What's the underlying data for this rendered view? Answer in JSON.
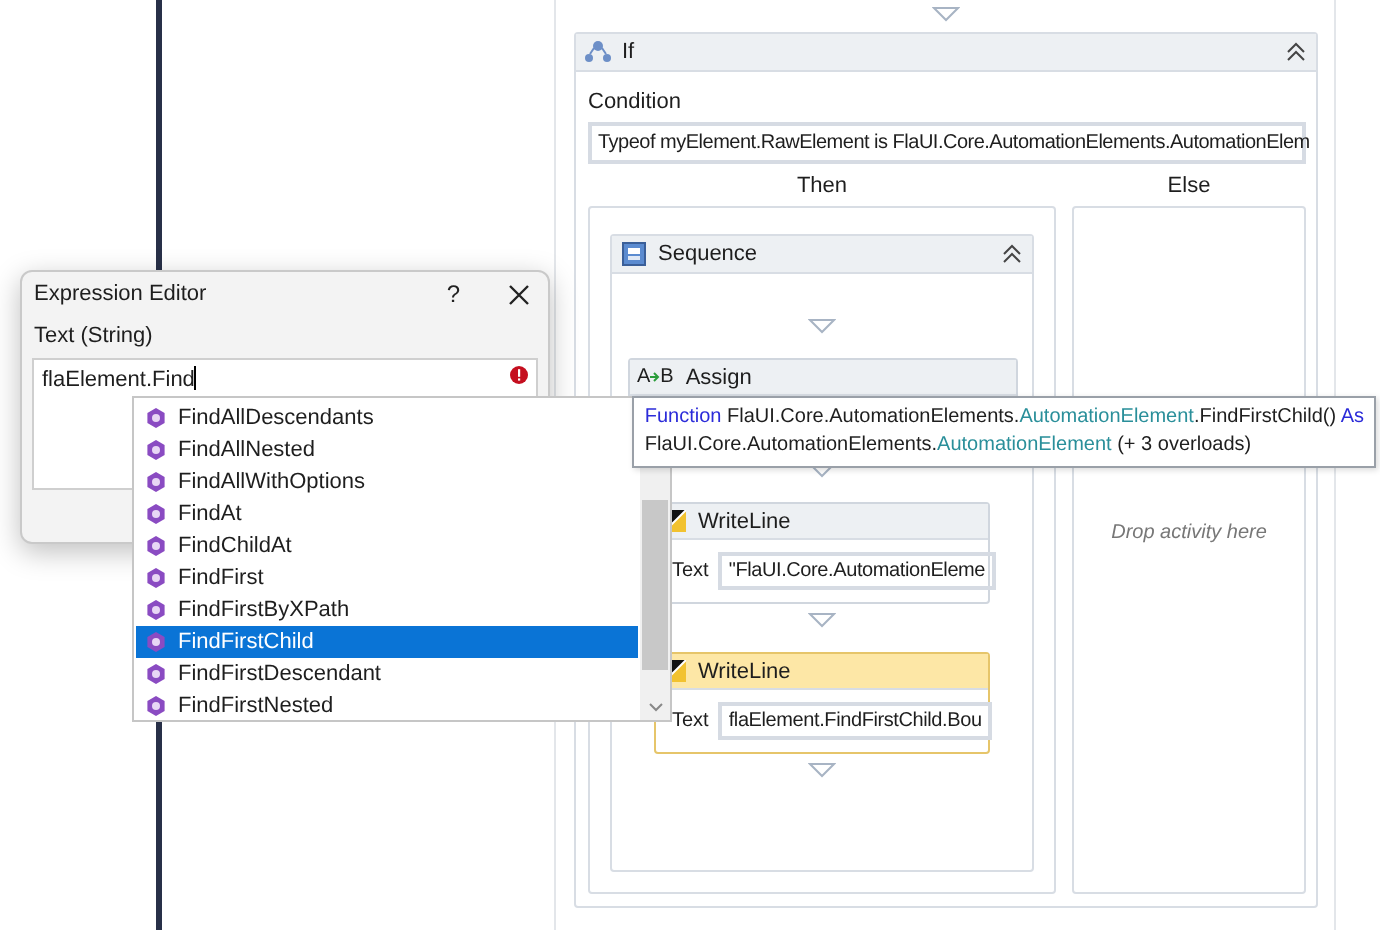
{
  "if_activity": {
    "title": "If",
    "condition_label": "Condition",
    "condition": "Typeof myElement.RawElement is FlaUI.Core.AutomationElements.AutomationElem"
  },
  "branches": [
    {
      "label": "Then"
    },
    {
      "label": "Else",
      "placeholder": "Drop activity here"
    }
  ],
  "sequence": {
    "title": "Sequence",
    "activities": [
      {
        "kind": "assign",
        "title": "Assign",
        "icon_text": [
          "A",
          "B"
        ],
        "selected": false
      },
      {
        "kind": "writeline",
        "title": "WriteLine",
        "field_label": "Text",
        "value": "\"FlaUI.Core.AutomationEleme",
        "selected": false
      },
      {
        "kind": "writeline",
        "title": "WriteLine",
        "field_label": "Text",
        "value": "flaElement.FindFirstChild.Bou",
        "selected": true
      }
    ]
  },
  "expression_editor": {
    "title": "Expression Editor",
    "help": "?",
    "label": "Text (String)",
    "value": "flaElement.Find",
    "error": true
  },
  "completion_list": {
    "items": [
      {
        "label": "FindAllDescendants",
        "selected": false
      },
      {
        "label": "FindAllNested",
        "selected": false
      },
      {
        "label": "FindAllWithOptions",
        "selected": false
      },
      {
        "label": "FindAt",
        "selected": false
      },
      {
        "label": "FindChildAt",
        "selected": false
      },
      {
        "label": "FindFirst",
        "selected": false
      },
      {
        "label": "FindFirstByXPath",
        "selected": false
      },
      {
        "label": "FindFirstChild",
        "selected": true
      },
      {
        "label": "FindFirstDescendant",
        "selected": false
      },
      {
        "label": "FindFirstNested",
        "selected": false
      }
    ]
  },
  "tooltip": {
    "lines": [
      [
        {
          "text": "Function",
          "kind": "keyword"
        },
        {
          "text": " FlaUI.Core.AutomationElements.",
          "kind": "plain"
        },
        {
          "text": "AutomationElement",
          "kind": "type"
        },
        {
          "text": ".FindFirstChild() ",
          "kind": "plain"
        },
        {
          "text": "As",
          "kind": "keyword"
        }
      ],
      [
        {
          "text": "FlaUI.Core.AutomationElements.",
          "kind": "plain"
        },
        {
          "text": "AutomationElement",
          "kind": "type"
        },
        {
          "text": " (+ 3 overloads)",
          "kind": "plain"
        }
      ]
    ]
  }
}
